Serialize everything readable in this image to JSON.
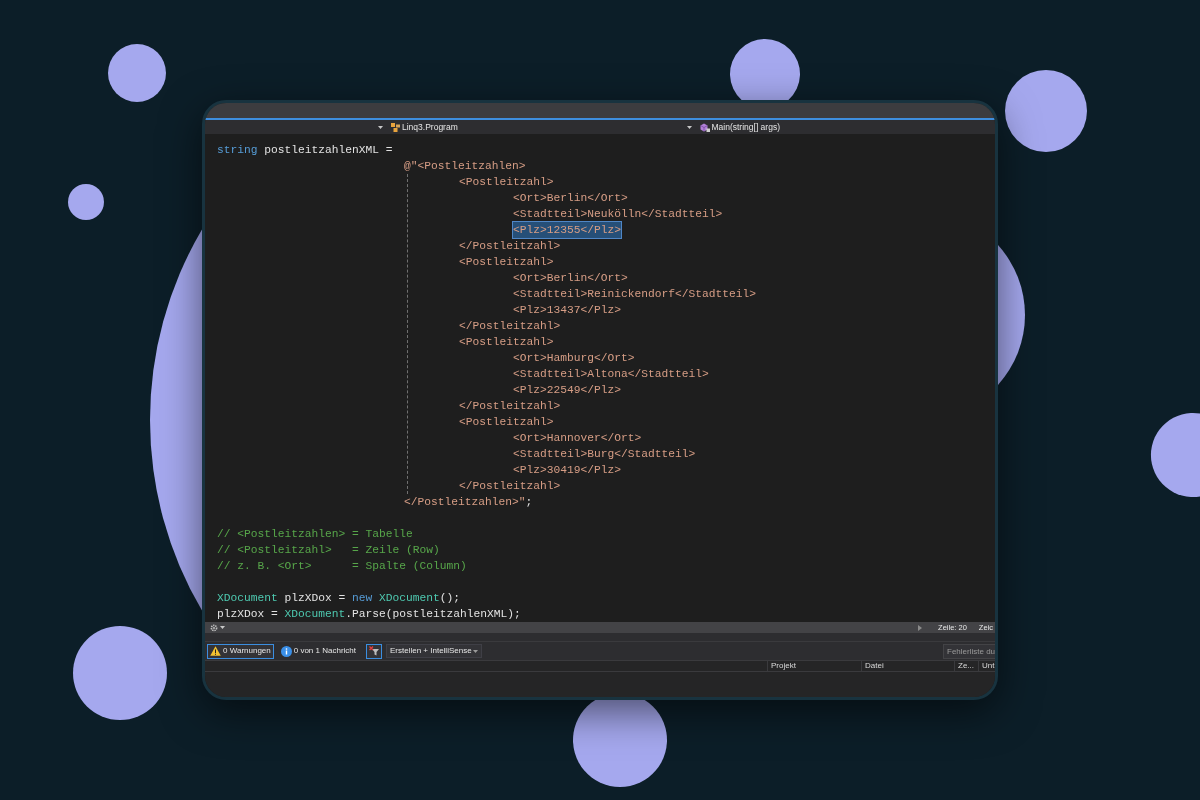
{
  "navigation_bar": {
    "dropdowns": [
      {
        "kind": "class",
        "label": "Linq3.Program"
      },
      {
        "kind": "method",
        "label": "Main(string[] args)"
      }
    ]
  },
  "code": {
    "blocks": [
      [
        {
          "tokens": [
            {
              "kind": "keyword",
              "text": "string"
            },
            {
              "kind": "plain",
              "text": " postleitzahlenXML ="
            }
          ],
          "selected": false,
          "children": [
            {
              "tokens": [
                {
                  "kind": "string",
                  "text": "@\"<Postleitzahlen>"
                }
              ],
              "selected": false,
              "children": [
                {
                  "tokens": [
                    {
                      "kind": "string",
                      "text": "<Postleitzahl>"
                    }
                  ],
                  "selected": false,
                  "children": [
                    {
                      "tokens": [
                        {
                          "kind": "string",
                          "text": "<Ort>Berlin</Ort>"
                        }
                      ],
                      "selected": false
                    },
                    {
                      "tokens": [
                        {
                          "kind": "string",
                          "text": "<Stadtteil>Neukölln</Stadtteil>"
                        }
                      ],
                      "selected": false
                    },
                    {
                      "tokens": [
                        {
                          "kind": "string",
                          "text": "<Plz>12355</Plz>"
                        }
                      ],
                      "selected": true
                    }
                  ]
                },
                {
                  "tokens": [
                    {
                      "kind": "string",
                      "text": "</Postleitzahl>"
                    }
                  ],
                  "selected": false
                },
                {
                  "tokens": [
                    {
                      "kind": "string",
                      "text": "<Postleitzahl>"
                    }
                  ],
                  "selected": false,
                  "children": [
                    {
                      "tokens": [
                        {
                          "kind": "string",
                          "text": "<Ort>Berlin</Ort>"
                        }
                      ],
                      "selected": false
                    },
                    {
                      "tokens": [
                        {
                          "kind": "string",
                          "text": "<Stadtteil>Reinickendorf</Stadtteil>"
                        }
                      ],
                      "selected": false
                    },
                    {
                      "tokens": [
                        {
                          "kind": "string",
                          "text": "<Plz>13437</Plz>"
                        }
                      ],
                      "selected": false
                    }
                  ]
                },
                {
                  "tokens": [
                    {
                      "kind": "string",
                      "text": "</Postleitzahl>"
                    }
                  ],
                  "selected": false
                },
                {
                  "tokens": [
                    {
                      "kind": "string",
                      "text": "<Postleitzahl>"
                    }
                  ],
                  "selected": false,
                  "children": [
                    {
                      "tokens": [
                        {
                          "kind": "string",
                          "text": "<Ort>Hamburg</Ort>"
                        }
                      ],
                      "selected": false
                    },
                    {
                      "tokens": [
                        {
                          "kind": "string",
                          "text": "<Stadtteil>Altona</Stadtteil>"
                        }
                      ],
                      "selected": false
                    },
                    {
                      "tokens": [
                        {
                          "kind": "string",
                          "text": "<Plz>22549</Plz>"
                        }
                      ],
                      "selected": false
                    }
                  ]
                },
                {
                  "tokens": [
                    {
                      "kind": "string",
                      "text": "</Postleitzahl>"
                    }
                  ],
                  "selected": false
                },
                {
                  "tokens": [
                    {
                      "kind": "string",
                      "text": "<Postleitzahl>"
                    }
                  ],
                  "selected": false,
                  "children": [
                    {
                      "tokens": [
                        {
                          "kind": "string",
                          "text": "<Ort>Hannover</Ort>"
                        }
                      ],
                      "selected": false
                    },
                    {
                      "tokens": [
                        {
                          "kind": "string",
                          "text": "<Stadtteil>Burg</Stadtteil>"
                        }
                      ],
                      "selected": false
                    },
                    {
                      "tokens": [
                        {
                          "kind": "string",
                          "text": "<Plz>30419</Plz>"
                        }
                      ],
                      "selected": false
                    }
                  ]
                },
                {
                  "tokens": [
                    {
                      "kind": "string",
                      "text": "</Postleitzahl>"
                    }
                  ],
                  "selected": false
                }
              ]
            },
            {
              "tokens": [
                {
                  "kind": "string",
                  "text": "</Postleitzahlen>\""
                },
                {
                  "kind": "plain",
                  "text": ";"
                }
              ],
              "selected": false
            }
          ]
        }
      ],
      [
        {
          "tokens": [
            {
              "kind": "comment",
              "text": "// <Postleitzahlen> = Tabelle"
            }
          ],
          "selected": false
        },
        {
          "tokens": [
            {
              "kind": "comment",
              "text": "// <Postleitzahl>   = Zeile (Row)"
            }
          ],
          "selected": false
        },
        {
          "tokens": [
            {
              "kind": "comment",
              "text": "// z. B. <Ort>      = Spalte (Column)"
            }
          ],
          "selected": false
        }
      ],
      [
        {
          "tokens": [
            {
              "kind": "type",
              "text": "XDocument"
            },
            {
              "kind": "plain",
              "text": " plzXDox = "
            },
            {
              "kind": "keyword",
              "text": "new"
            },
            {
              "kind": "type",
              "text": " XDocument"
            },
            {
              "kind": "plain",
              "text": "();"
            }
          ],
          "selected": false
        },
        {
          "tokens": [
            {
              "kind": "plain",
              "text": "plzXDox = "
            },
            {
              "kind": "type",
              "text": "XDocument"
            },
            {
              "kind": "plain",
              "text": ".Parse(postleitzahlenXML);"
            }
          ],
          "selected": false
        }
      ]
    ]
  },
  "status_bar": {
    "items": [
      "Zeile: 20",
      "Zeic"
    ]
  },
  "error_list": {
    "filters": [
      {
        "kind": "warning",
        "label": "0 Warnungen",
        "on": true
      },
      {
        "kind": "info",
        "label": "0 von 1 Nachricht",
        "on": false
      }
    ],
    "filter_toggle": {
      "on": true
    },
    "scope": {
      "value": "Erstellen + IntelliSense"
    },
    "search": {
      "placeholder": "Fehlerliste du"
    },
    "columns": [
      "Projekt",
      "Datei",
      "Ze...",
      "Unt"
    ]
  }
}
